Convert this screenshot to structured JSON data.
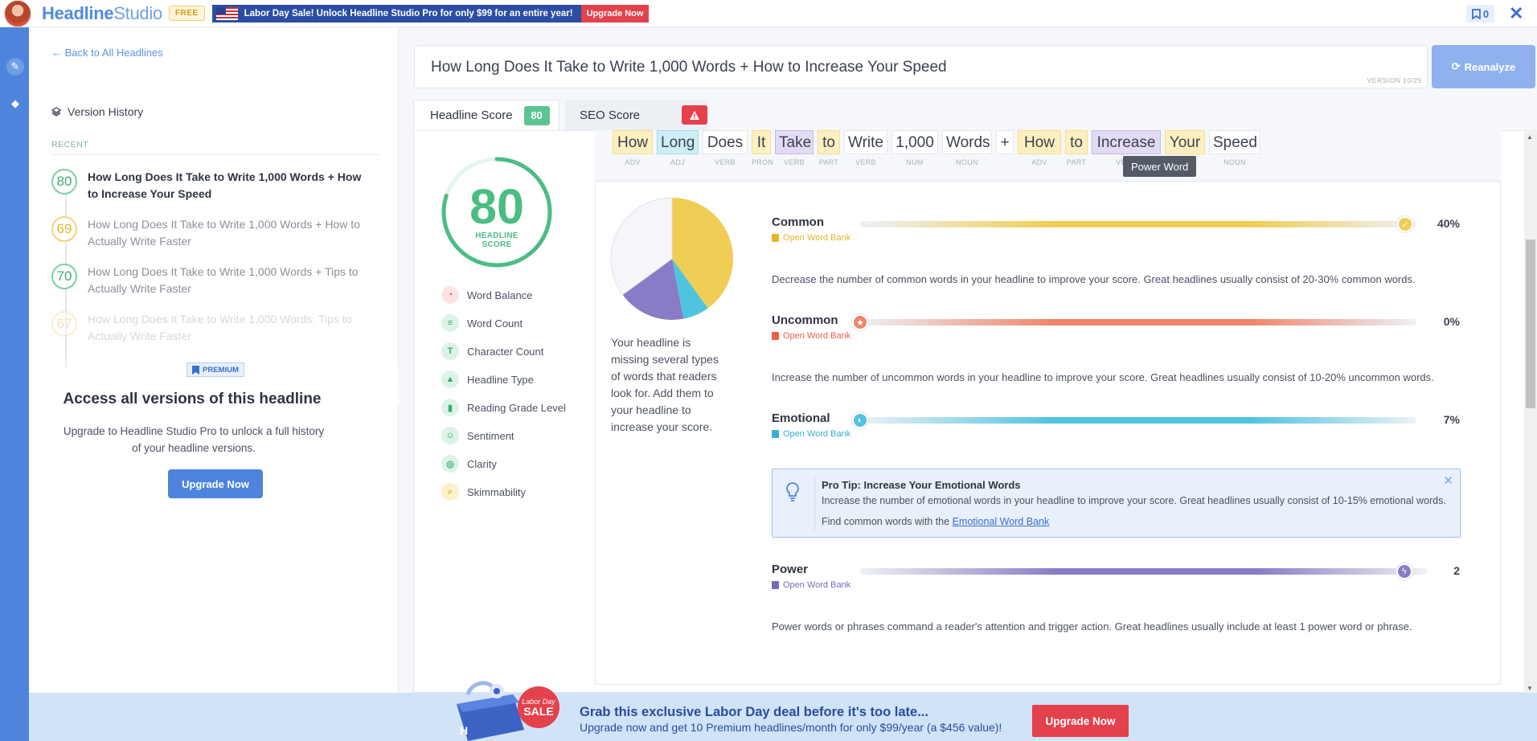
{
  "topbar": {
    "brand_bold": "Headline",
    "brand_light": "Studio",
    "plan_badge": "FREE",
    "promo_text": "Labor Day Sale! Unlock Headline Studio Pro for only $99 for an entire year!",
    "promo_button": "Upgrade Now",
    "bookmark_count": "0"
  },
  "left_panel": {
    "back_link": "← Back to All Headlines",
    "version_history": "Version History",
    "recent_label": "RECENT",
    "history": [
      {
        "score": "80",
        "title": "How Long Does It Take to Write 1,000 Words + How to Increase Your Speed",
        "state": "current"
      },
      {
        "score": "69",
        "title": "How Long Does It Take to Write 1,000 Words + How to Actually Write Faster",
        "state": "past"
      },
      {
        "score": "70",
        "title": "How Long Does It Take to Write 1,000 Words + Tips to Actually Write Faster",
        "state": "past"
      },
      {
        "score": "67",
        "title": "How Long Does It Take to Write 1,000 Words: Tips to Actually Write Faster",
        "state": "locked"
      }
    ],
    "premium_badge": "PREMIUM",
    "access_title": "Access all versions of this headline",
    "access_desc": "Upgrade to Headline Studio Pro to unlock a full history of your headline versions.",
    "upgrade_button": "Upgrade Now"
  },
  "editor": {
    "headline": "How Long Does It Take to Write 1,000 Words + How to Increase Your Speed",
    "version": "VERSION 10/25",
    "reanalyze_button": "Reanalyze"
  },
  "tabs": [
    {
      "label": "Headline Score",
      "badge": "80",
      "active": true
    },
    {
      "label": "SEO Score",
      "badge": "!",
      "active": false
    }
  ],
  "score": {
    "value": "80",
    "label_line1": "HEADLINE",
    "label_line2": "SCORE",
    "fraction": 0.8
  },
  "menu": [
    {
      "label": "Word Balance",
      "icon": "pie-chart-icon",
      "color": "#e3414c",
      "bg": "#fde4e4"
    },
    {
      "label": "Word Count",
      "icon": "lines-icon",
      "color": "#3cab6e",
      "bg": "#dcf3e6"
    },
    {
      "label": "Character Count",
      "icon": "text-t-icon",
      "color": "#3cab6e",
      "bg": "#dcf3e6"
    },
    {
      "label": "Headline Type",
      "icon": "shapes-icon",
      "color": "#3cab6e",
      "bg": "#dcf3e6"
    },
    {
      "label": "Reading Grade Level",
      "icon": "book-icon",
      "color": "#3cab6e",
      "bg": "#dcf3e6"
    },
    {
      "label": "Sentiment",
      "icon": "smile-icon",
      "color": "#3cab6e",
      "bg": "#dcf3e6"
    },
    {
      "label": "Clarity",
      "icon": "target-icon",
      "color": "#3cab6e",
      "bg": "#dcf3e6"
    },
    {
      "label": "Skimmability",
      "icon": "magnifier-icon",
      "color": "#e5b52a",
      "bg": "#fdf1c9"
    }
  ],
  "words": [
    {
      "text": "How",
      "pos": "ADV",
      "type": "common"
    },
    {
      "text": "Long",
      "pos": "ADJ",
      "type": "emotional"
    },
    {
      "text": "Does",
      "pos": "VERB",
      "type": "plain"
    },
    {
      "text": "It",
      "pos": "PRON",
      "type": "common"
    },
    {
      "text": "Take",
      "pos": "VERB",
      "type": "power"
    },
    {
      "text": "to",
      "pos": "PART",
      "type": "common"
    },
    {
      "text": "Write",
      "pos": "VERB",
      "type": "plain"
    },
    {
      "text": "1,000",
      "pos": "NUM",
      "type": "plain"
    },
    {
      "text": "Words",
      "pos": "NOUN",
      "type": "plain"
    },
    {
      "text": "+",
      "pos": "",
      "type": "plain"
    },
    {
      "text": "How",
      "pos": "ADV",
      "type": "common"
    },
    {
      "text": "to",
      "pos": "PART",
      "type": "common"
    },
    {
      "text": "Increase",
      "pos": "VERB",
      "type": "power"
    },
    {
      "text": "Your",
      "pos": "PRON",
      "type": "common"
    },
    {
      "text": "Speed",
      "pos": "NOUN",
      "type": "plain"
    }
  ],
  "tooltip": "Power Word",
  "word_balance": {
    "summary": "Your headline is missing several types of words that readers look for. Add them to your headline to increase your score.",
    "pie": [
      {
        "name": "Common",
        "value": 40,
        "color": "#f0cd55"
      },
      {
        "name": "Emotional",
        "value": 7,
        "color": "#4fc3e0"
      },
      {
        "name": "Power",
        "value": 18,
        "color": "#8a7bc6"
      },
      {
        "name": "Other",
        "value": 35,
        "color": "#f4f6fa"
      }
    ],
    "metrics": [
      {
        "name": "Common",
        "value": "40%",
        "bank": "Open Word Bank",
        "desc": "Decrease the number of common words in your headline to improve your score. Great headlines usually consist of 20-30% common words.",
        "color": "#f0cd55",
        "bank_color": "#e5b52a",
        "level": 0.98,
        "knob_icon": "✓"
      },
      {
        "name": "Uncommon",
        "value": "0%",
        "bank": "Open Word Bank",
        "desc": "Increase the number of uncommon words in your headline to improve your score. Great headlines usually consist of 10-20% uncommon words.",
        "color": "#f08468",
        "bank_color": "#ee5f48",
        "level": 0.0,
        "knob_icon": "★"
      },
      {
        "name": "Emotional",
        "value": "7%",
        "bank": "Open Word Bank",
        "desc": "",
        "color": "#4fc3e0",
        "bank_color": "#3aaed0",
        "level": 0.0,
        "knob_icon": "◐"
      },
      {
        "name": "Power",
        "value": "2",
        "bank": "Open Word Bank",
        "desc": "Power words or phrases command a reader's attention and trigger action. Great headlines usually include at least 1 power word or phrase.",
        "color": "#8a7bc6",
        "bank_color": "#7a68bd",
        "level": 0.96,
        "knob_icon": "ϟ"
      }
    ],
    "pro_tip": {
      "title": "Pro Tip: Increase Your Emotional Words",
      "body": "Increase the number of emotional words in your headline to improve your score. Great headlines usually consist of 10-15% emotional words.",
      "find_prefix": "Find common words with the ",
      "link": "Emotional Word Bank"
    }
  },
  "banner": {
    "title": "Grab this exclusive Labor Day deal before it's too late...",
    "subtitle": "Upgrade now and get 10 Premium headlines/month for only $99/year (a $456 value)!",
    "button": "Upgrade Now",
    "sticker_line1": "Labor Day",
    "sticker_line2": "SALE"
  }
}
